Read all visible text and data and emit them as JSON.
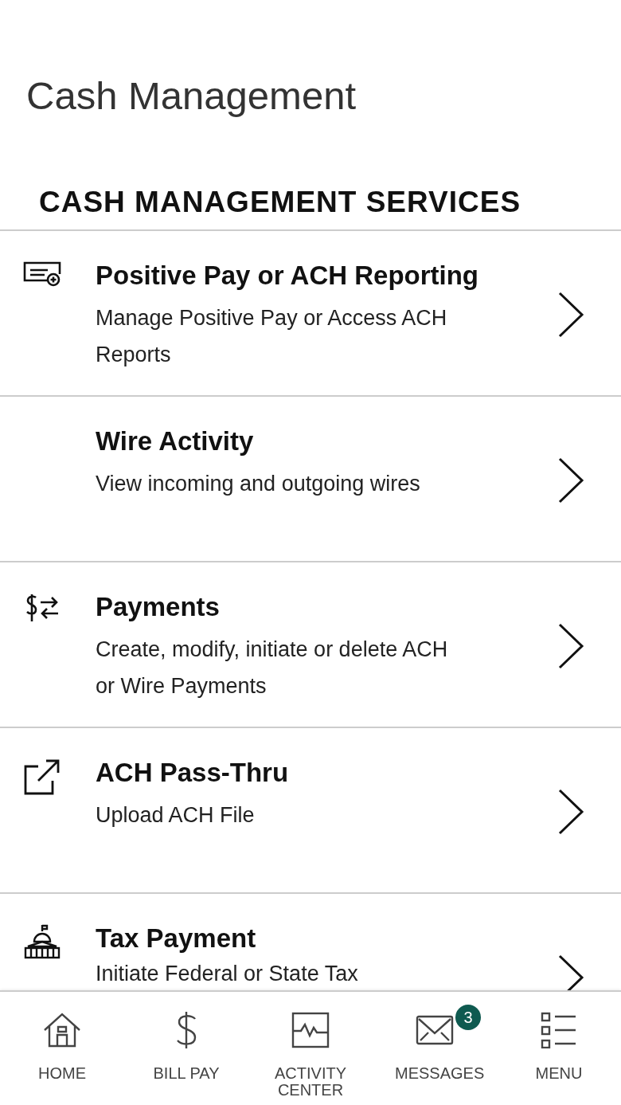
{
  "page_title": "Cash Management",
  "section_heading": "CASH MANAGEMENT SERVICES",
  "services": [
    {
      "kind": "check",
      "title": "Positive Pay or ACH Reporting",
      "description": "Manage Positive Pay or Access ACH Reports"
    },
    {
      "kind": "none",
      "title": "Wire Activity",
      "description": "View incoming and outgoing wires"
    },
    {
      "kind": "transfer",
      "title": "Payments",
      "description": "Create, modify, initiate or delete ACH or Wire Payments"
    },
    {
      "kind": "external",
      "title": "ACH Pass-Thru",
      "description": "Upload ACH File"
    },
    {
      "kind": "capitol",
      "title": "Tax Payment",
      "description": "Initiate Federal or State Tax"
    }
  ],
  "bottom_nav": [
    {
      "kind": "home",
      "label": "HOME"
    },
    {
      "kind": "dollar",
      "label": "BILL PAY"
    },
    {
      "kind": "activity",
      "label": "ACTIVITY CENTER"
    },
    {
      "kind": "mail",
      "label": "MESSAGES",
      "badge": "3"
    },
    {
      "kind": "list",
      "label": "MENU"
    }
  ]
}
